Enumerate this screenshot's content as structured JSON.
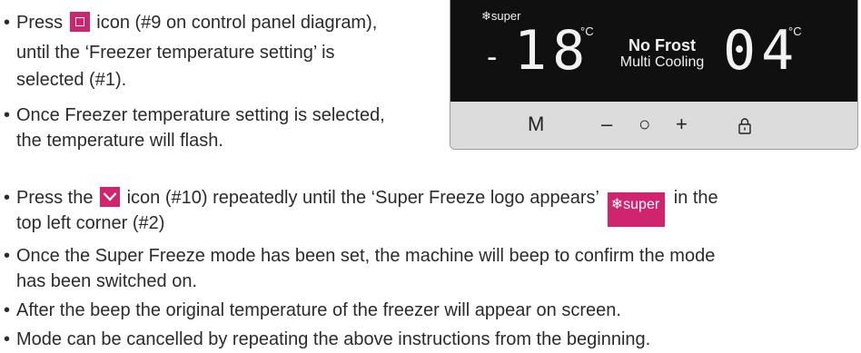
{
  "bullets": {
    "b1_pre": "Press",
    "b1_post": "icon (#9 on control panel diagram),",
    "b1_line2": "until the ‘Freezer temperature setting’ is",
    "b1_line3": "selected (#1).",
    "b2_line1": "Once Freezer temperature setting is selected,",
    "b2_line2": "the temperature will flash.",
    "b3_pre": "Press the",
    "b3_mid": "icon (#10) repeatedly until the ‘Super Freeze logo appears’",
    "b3_post": "in the",
    "b3_line2": "top left corner (#2)",
    "b4_line1": "Once the Super Freeze mode has been set, the machine will beep to confirm the mode",
    "b4_line2": "has been switched on.",
    "b5": "After the beep the original temperature of the freezer will appear on screen.",
    "b6": "Mode can be cancelled by repeating the above instructions from the beginning.",
    "bullet_char": "•"
  },
  "badge": {
    "text": "super",
    "icon": "snowflake-icon"
  },
  "display": {
    "super_label": "super",
    "minus": "-",
    "freezer_temp": "18",
    "unit": "°C",
    "no_frost": "No Frost",
    "multi_cooling": "Multi Cooling",
    "fridge_temp": "04"
  },
  "control_buttons": {
    "mode": "M",
    "minus": "–",
    "circle": "○",
    "plus": "+",
    "lock": "lock-icon"
  },
  "colors": {
    "accent": "#d1246f",
    "screen": "#101010",
    "button_bar": "#dcdcdc"
  }
}
